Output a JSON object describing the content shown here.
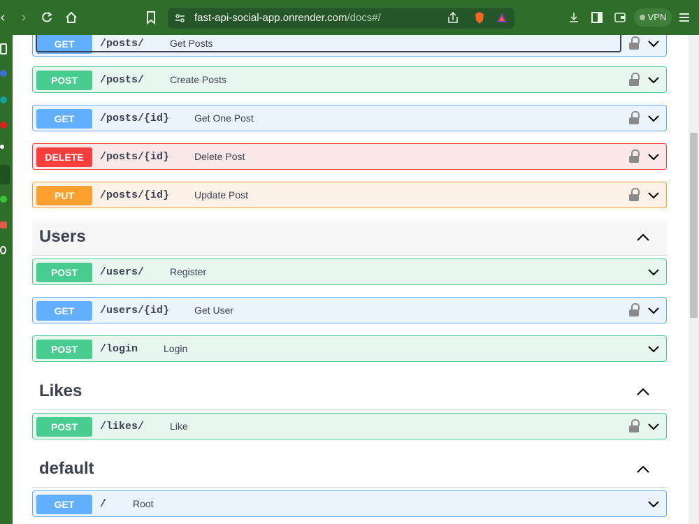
{
  "browser": {
    "url_host": "fast-api-social-app.onrender.com",
    "url_path": "/docs#/",
    "vpn_label": "VPN",
    "icons": [
      "back-icon",
      "forward-icon",
      "reload-icon",
      "home-icon",
      "bookmark-icon",
      "site-info-icon",
      "share-icon",
      "brave-shield-icon",
      "rewards-icon",
      "download-icon",
      "sidebar-icon",
      "wallet-icon",
      "menu-icon"
    ]
  },
  "colors": {
    "chrome": "#2f6d2b",
    "get": "#61affe",
    "post": "#49cc90",
    "delete": "#f93e3e",
    "put": "#fca130",
    "text": "#3b4151"
  },
  "posts_ops": [
    {
      "method": "GET",
      "path": "/posts/",
      "summary": "Get Posts",
      "locked": true
    },
    {
      "method": "POST",
      "path": "/posts/",
      "summary": "Create Posts",
      "locked": true
    },
    {
      "method": "GET",
      "path": "/posts/{id}",
      "summary": "Get One Post",
      "locked": true
    },
    {
      "method": "DELETE",
      "path": "/posts/{id}",
      "summary": "Delete Post",
      "locked": true
    },
    {
      "method": "PUT",
      "path": "/posts/{id}",
      "summary": "Update Post",
      "locked": true
    }
  ],
  "tags": [
    {
      "name": "Users",
      "ops": [
        {
          "method": "POST",
          "path": "/users/",
          "summary": "Register",
          "locked": false
        },
        {
          "method": "GET",
          "path": "/users/{id}",
          "summary": "Get User",
          "locked": true
        },
        {
          "method": "POST",
          "path": "/login",
          "summary": "Login",
          "locked": false
        }
      ]
    },
    {
      "name": "Likes",
      "ops": [
        {
          "method": "POST",
          "path": "/likes/",
          "summary": "Like",
          "locked": true
        }
      ]
    },
    {
      "name": "default",
      "ops": [
        {
          "method": "GET",
          "path": "/",
          "summary": "Root",
          "locked": false
        }
      ]
    }
  ]
}
